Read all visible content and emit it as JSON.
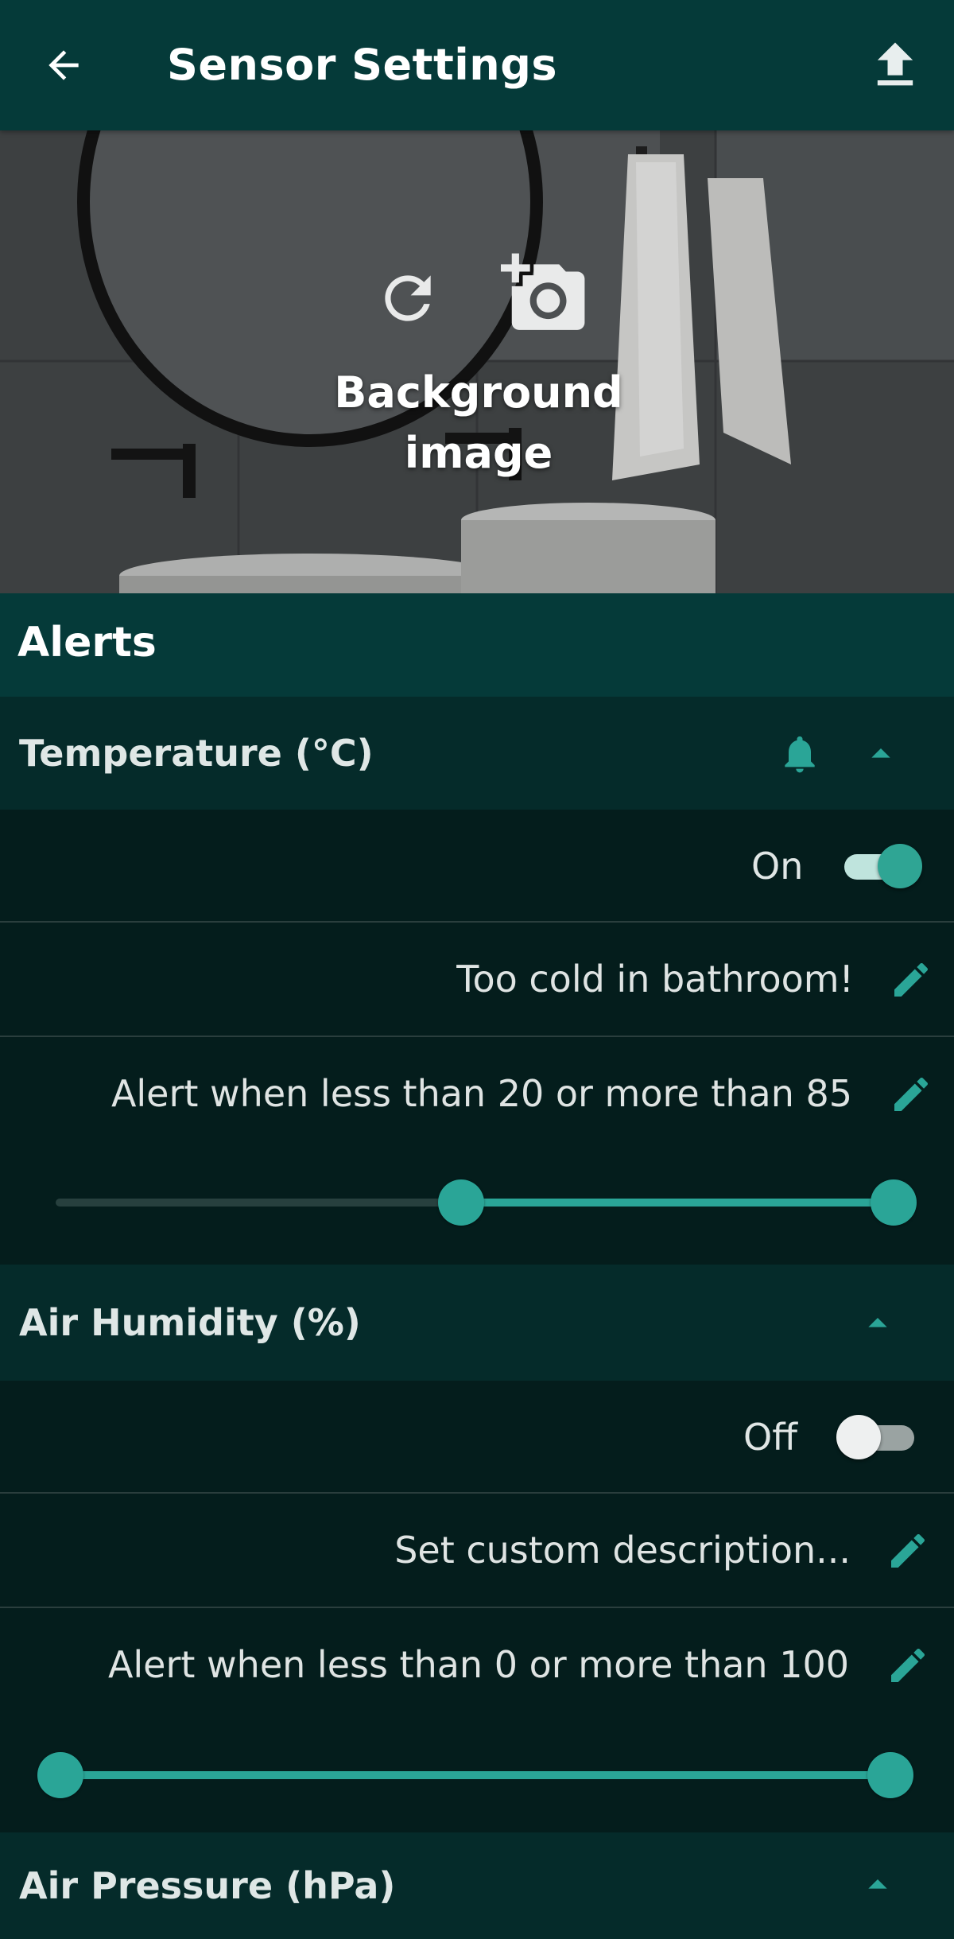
{
  "header": {
    "title": "Sensor Settings",
    "back_icon": "arrow-left-icon",
    "upload_icon": "upload-icon"
  },
  "background": {
    "label": "Background image",
    "refresh_icon": "refresh-icon",
    "add_photo_icon": "add-photo-icon"
  },
  "alerts": {
    "title": "Alerts",
    "sections": [
      {
        "name": "Temperature (°C)",
        "bell_active": true,
        "expanded": true,
        "toggle_label": "On",
        "toggle_on": true,
        "description": "Too cold in bathroom!",
        "range_text": "Alert when less than 20 or more than 85",
        "range_low": 20,
        "range_high": 85
      },
      {
        "name": "Air Humidity (%)",
        "bell_active": false,
        "expanded": true,
        "toggle_label": "Off",
        "toggle_on": false,
        "description": "Set custom description...",
        "range_text": "Alert when less than 0 or more than 100",
        "range_low": 0,
        "range_high": 100
      },
      {
        "name": "Air Pressure (hPa)",
        "bell_active": false,
        "expanded": true
      }
    ]
  },
  "colors": {
    "accent": "#2aa597",
    "topbar": "#053a39",
    "section_header": "#052b2a",
    "row_bg": "#041d1c"
  }
}
